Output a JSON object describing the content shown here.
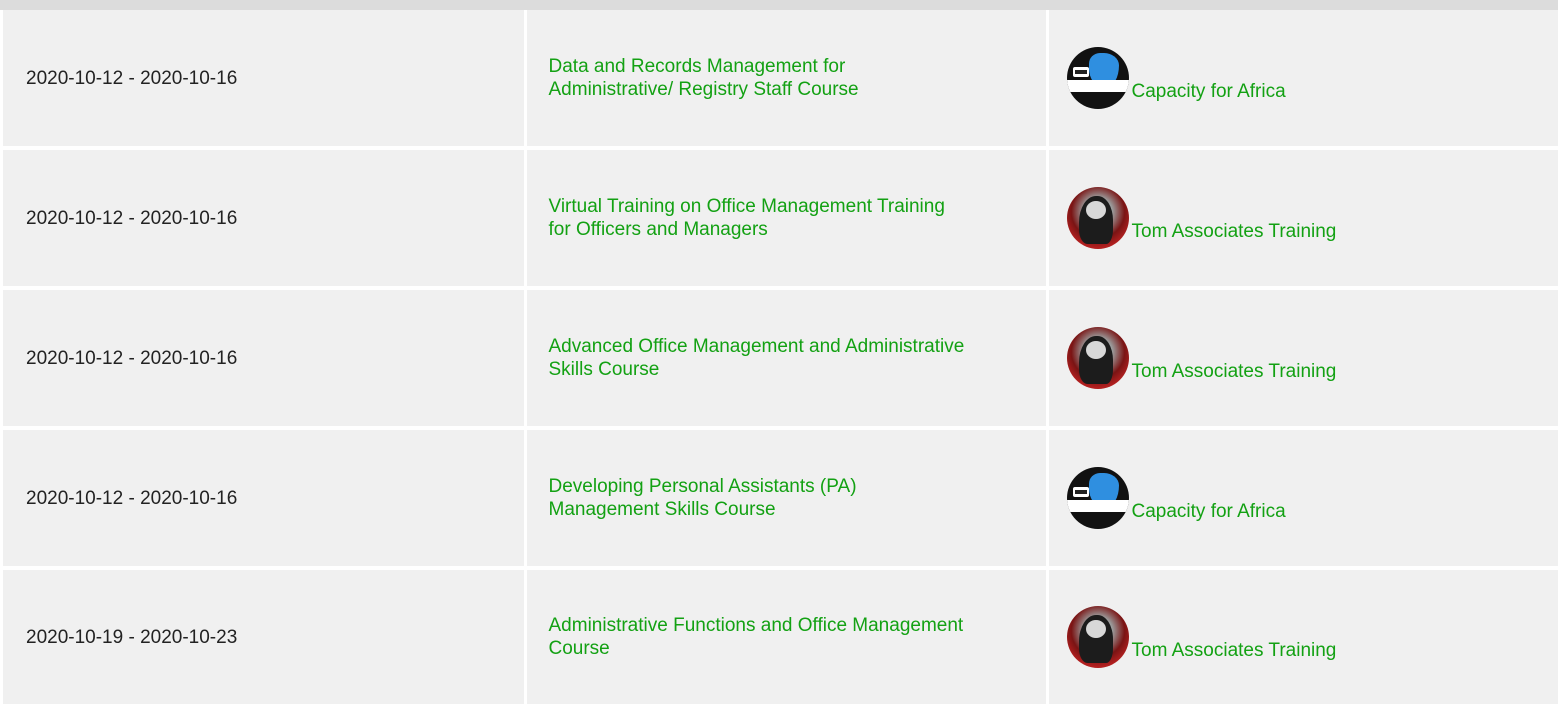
{
  "rows": [
    {
      "date": "2020-10-12 - 2020-10-16",
      "course": "Data and Records Management for Administrative/ Registry Staff Course",
      "provider": "Capacity for Africa",
      "logo_icon": "capacity-for-africa-logo-icon",
      "logo_text": "Capacity for Africa"
    },
    {
      "date": "2020-10-12 - 2020-10-16",
      "course": "Virtual Training on Office Management Training for Officers and Managers",
      "provider": "Tom Associates Training",
      "logo_icon": "tom-associates-logo-icon"
    },
    {
      "date": "2020-10-12 - 2020-10-16",
      "course": "Advanced Office Management and Administrative Skills Course",
      "provider": "Tom Associates Training",
      "logo_icon": "tom-associates-logo-icon"
    },
    {
      "date": "2020-10-12 - 2020-10-16",
      "course": "Developing Personal Assistants (PA) Management Skills Course",
      "provider": "Capacity for Africa",
      "logo_icon": "capacity-for-africa-logo-icon",
      "logo_text": "Capacity for Africa"
    },
    {
      "date": "2020-10-19 - 2020-10-23",
      "course": "Administrative Functions and Office Management Course",
      "provider": "Tom Associates Training",
      "logo_icon": "tom-associates-logo-icon"
    }
  ],
  "colors": {
    "link": "#13a113",
    "row_bg": "#f0f0f0",
    "text": "#222222"
  }
}
